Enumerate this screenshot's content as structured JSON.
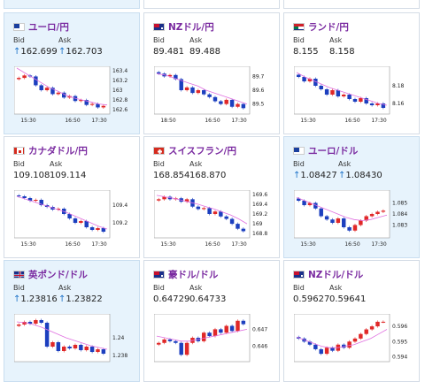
{
  "colors": {
    "up": "#e02828",
    "down": "#1c3fbf",
    "ma": "#e070e0",
    "link": "#7a2aa0",
    "accent": "#1f73c9"
  },
  "labels": {
    "bid": "Bid",
    "ask": "Ask"
  },
  "cards": [
    {
      "flag": "eu-flag-icon",
      "title": "ユーロ/円",
      "bid": "162.699",
      "ask": "162.703",
      "arrow": true,
      "yticks": [
        "163.4",
        "163.2",
        "163",
        "162.8",
        "162.6"
      ],
      "xticks": [
        "15:30",
        "16:50",
        "17:30"
      ],
      "closes": [
        163.25,
        163.3,
        163.28,
        163.1,
        163.0,
        163.05,
        162.92,
        162.95,
        162.85,
        162.88,
        162.78,
        162.8,
        162.7,
        162.72,
        162.65,
        162.68
      ],
      "ma": [
        163.45,
        163.35,
        163.25,
        163.15,
        163.05,
        162.98,
        162.9,
        162.84,
        162.8,
        162.76,
        162.72,
        162.7
      ],
      "ylim": [
        162.55,
        163.45
      ],
      "hl": true
    },
    {
      "flag": "nz-flag-icon",
      "title": "NZドル/円",
      "bid": "89.481",
      "ask": "89.488",
      "arrow": false,
      "yticks": [
        "89.7",
        "89.6",
        "89.5"
      ],
      "xticks": [
        "18:50",
        "16:50",
        "17:30"
      ],
      "closes": [
        89.72,
        89.7,
        89.71,
        89.68,
        89.6,
        89.62,
        89.58,
        89.6,
        89.57,
        89.55,
        89.52,
        89.5,
        89.53,
        89.48,
        89.5,
        89.47
      ],
      "ma": [
        89.72,
        89.71,
        89.69,
        89.67,
        89.65,
        89.63,
        89.6,
        89.58,
        89.56,
        89.54,
        89.52,
        89.5
      ],
      "ylim": [
        89.44,
        89.76
      ],
      "hl": false
    },
    {
      "flag": "za-flag-icon",
      "title": "ランド/円",
      "bid": "8.155",
      "ask": "8.158",
      "arrow": false,
      "yticks": [
        "8.18",
        "8.16"
      ],
      "xticks": [
        "15:30",
        "16:50",
        "17:30"
      ],
      "closes": [
        8.19,
        8.185,
        8.188,
        8.18,
        8.176,
        8.17,
        8.175,
        8.168,
        8.17,
        8.165,
        8.162,
        8.166,
        8.16,
        8.158,
        8.16,
        8.155
      ],
      "ma": [
        8.195,
        8.19,
        8.186,
        8.182,
        8.178,
        8.175,
        8.172,
        8.169,
        8.166,
        8.163,
        8.16,
        8.158
      ],
      "ylim": [
        8.15,
        8.2
      ],
      "hl": false
    },
    {
      "flag": "ca-flag-icon",
      "title": "カナダドル/円",
      "bid": "109.108",
      "ask": "109.114",
      "arrow": false,
      "yticks": [
        "109.4",
        "109.2"
      ],
      "xticks": [
        "15:30",
        "16:50",
        "17:30"
      ],
      "closes": [
        109.5,
        109.48,
        109.45,
        109.46,
        109.4,
        109.38,
        109.35,
        109.36,
        109.3,
        109.25,
        109.2,
        109.22,
        109.15,
        109.12,
        109.14,
        109.1
      ],
      "ma": [
        109.5,
        109.47,
        109.44,
        109.41,
        109.38,
        109.35,
        109.32,
        109.28,
        109.24,
        109.2,
        109.16,
        109.13
      ],
      "ylim": [
        109.05,
        109.55
      ],
      "hl": false
    },
    {
      "flag": "ch-flag-icon",
      "title": "スイスフラン/円",
      "bid": "168.854",
      "ask": "168.870",
      "arrow": false,
      "yticks": [
        "169.6",
        "169.4",
        "169.2",
        "169",
        "168.8"
      ],
      "xticks": [
        "15:30",
        "16:50",
        "17:30"
      ],
      "closes": [
        169.5,
        169.55,
        169.5,
        169.52,
        169.45,
        169.5,
        169.35,
        169.3,
        169.32,
        169.2,
        169.25,
        169.15,
        169.1,
        169.0,
        168.9,
        168.85
      ],
      "ma": [
        169.58,
        169.55,
        169.52,
        169.48,
        169.44,
        169.4,
        169.35,
        169.3,
        169.24,
        169.18,
        169.1,
        169.0
      ],
      "ylim": [
        168.75,
        169.65
      ],
      "hl": false
    },
    {
      "flag": "eu-flag-icon",
      "title": "ユーロ/ドル",
      "bid": "1.08427",
      "ask": "1.08430",
      "arrow": true,
      "yticks": [
        "1.085",
        "1.084",
        "1.083"
      ],
      "xticks": [
        "15:30",
        "16:50",
        "17:30"
      ],
      "closes": [
        1.0852,
        1.0848,
        1.085,
        1.0845,
        1.0838,
        1.0835,
        1.0832,
        1.0836,
        1.0828,
        1.0825,
        1.083,
        1.0834,
        1.0838,
        1.084,
        1.0842,
        1.0843
      ],
      "ma": [
        1.0855,
        1.0852,
        1.0849,
        1.0846,
        1.0843,
        1.084,
        1.0837,
        1.0835,
        1.0834,
        1.0835,
        1.0837,
        1.0839
      ],
      "ylim": [
        1.082,
        1.086
      ],
      "hl": true
    },
    {
      "flag": "uk-flag-icon",
      "title": "英ポンド/ドル",
      "bid": "1.23816",
      "ask": "1.23822",
      "arrow": true,
      "yticks": [
        "1.24",
        "1.238"
      ],
      "xticks": [],
      "closes": [
        1.2415,
        1.2418,
        1.2416,
        1.242,
        1.2417,
        1.239,
        1.2395,
        1.2385,
        1.239,
        1.2388,
        1.2392,
        1.2386,
        1.239,
        1.2384,
        1.2387,
        1.2382
      ],
      "ma": [
        1.2418,
        1.2417,
        1.2415,
        1.2412,
        1.2408,
        1.2404,
        1.24,
        1.2397,
        1.2394,
        1.2391,
        1.2389,
        1.2387
      ],
      "ylim": [
        1.2375,
        1.2425
      ],
      "hl": true
    },
    {
      "flag": "au-flag-icon",
      "title": "豪ドル/ドル",
      "bid": "0.64729",
      "ask": "0.64733",
      "arrow": false,
      "yticks": [
        "0.647",
        "0.646"
      ],
      "xticks": [],
      "closes": [
        0.6462,
        0.6464,
        0.6463,
        0.6462,
        0.6455,
        0.6462,
        0.6465,
        0.6463,
        0.6468,
        0.6466,
        0.647,
        0.6468,
        0.6472,
        0.6469,
        0.6475,
        0.6473
      ],
      "ma": [
        0.6466,
        0.6465,
        0.6464,
        0.6463,
        0.6463,
        0.6464,
        0.6465,
        0.6466,
        0.6467,
        0.6468,
        0.6469,
        0.647
      ],
      "ylim": [
        0.6452,
        0.6478
      ],
      "hl": false
    },
    {
      "flag": "nz-flag-icon",
      "title": "NZドル/ドル",
      "bid": "0.59627",
      "ask": "0.59641",
      "arrow": false,
      "yticks": [
        "0.596",
        "0.595",
        "0.594"
      ],
      "xticks": [],
      "closes": [
        0.5952,
        0.595,
        0.5948,
        0.5945,
        0.5942,
        0.5946,
        0.5944,
        0.5948,
        0.5946,
        0.595,
        0.5952,
        0.5955,
        0.5958,
        0.596,
        0.5963,
        0.5963
      ],
      "ma": [
        0.5953,
        0.5951,
        0.5949,
        0.5947,
        0.5946,
        0.5946,
        0.5947,
        0.5948,
        0.595,
        0.5952,
        0.5955,
        0.5958
      ],
      "ylim": [
        0.5938,
        0.5967
      ],
      "hl": false
    }
  ]
}
